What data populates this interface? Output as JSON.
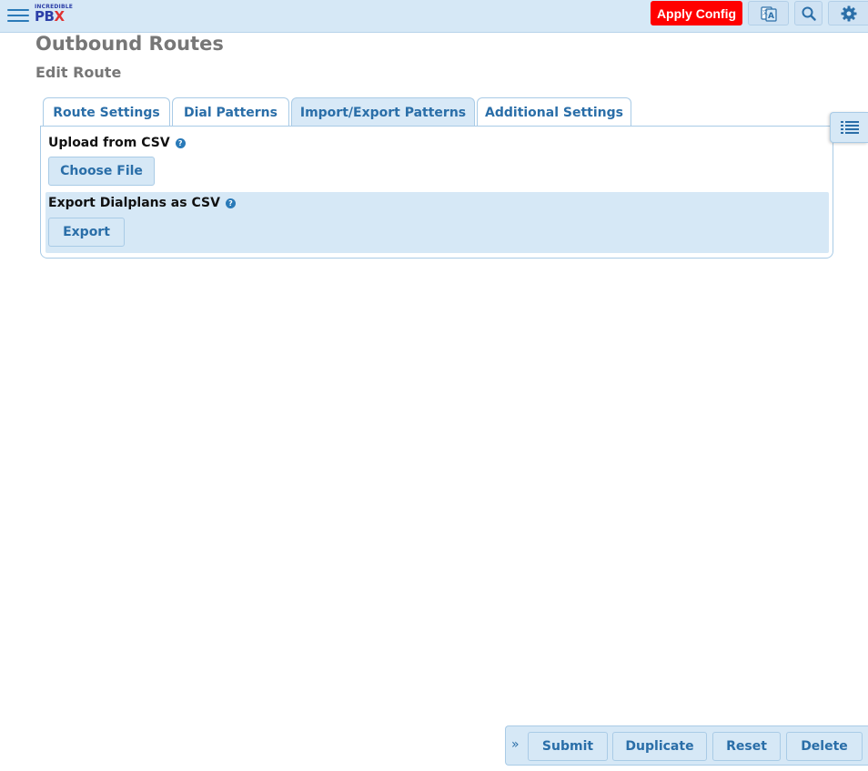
{
  "header": {
    "logo": {
      "line1": "INCREDIBLE",
      "line2_main": "PB",
      "line2_x": "X"
    },
    "apply_config_label": "Apply Config",
    "apply_config_color": "#ff0000",
    "icons": [
      "translate-icon",
      "search-icon",
      "gear-icon"
    ]
  },
  "page": {
    "title": "Outbound Routes",
    "subtitle": "Edit Route"
  },
  "tabs": [
    {
      "label": "Route Settings",
      "active": false
    },
    {
      "label": "Dial Patterns",
      "active": false
    },
    {
      "label": "Import/Export Patterns",
      "active": true
    },
    {
      "label": "Additional Settings",
      "active": false
    }
  ],
  "import_export": {
    "upload_label": "Upload from CSV",
    "choose_file_label": "Choose File",
    "export_label": "Export Dialplans as CSV",
    "export_button_label": "Export",
    "help_glyph": "?"
  },
  "action_bar": {
    "collapse_glyph": "»",
    "submit_label": "Submit",
    "duplicate_label": "Duplicate",
    "reset_label": "Reset",
    "delete_label": "Delete"
  },
  "colors": {
    "accent": "#2a6ea8",
    "panel_bg": "#d6e8f6",
    "title_gray": "#777777"
  }
}
